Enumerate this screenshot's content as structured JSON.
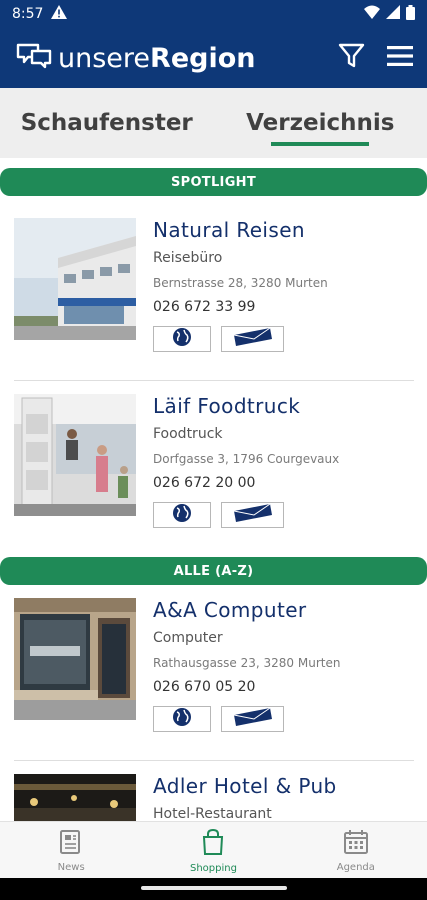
{
  "status_bar": {
    "time": "8:57"
  },
  "app_bar": {
    "brand_light": "unsere",
    "brand_bold": "Region"
  },
  "tabs": [
    {
      "label": "Schaufenster",
      "active": false
    },
    {
      "label": "Verzeichnis",
      "active": true
    }
  ],
  "sections": {
    "spotlight": "SPOTLIGHT",
    "all": "ALLE (A-Z)"
  },
  "listings": [
    {
      "name": "Natural Reisen",
      "category": "Reisebüro",
      "address": "Bernstrasse 28, 3280 Murten",
      "phone": "026 672 33 99"
    },
    {
      "name": "Läif Foodtruck",
      "category": "Foodtruck",
      "address": "Dorfgasse 3, 1796 Courgevaux",
      "phone": "026 672 20 00"
    },
    {
      "name": "A&A Computer",
      "category": "Computer",
      "address": "Rathausgasse 23, 3280 Murten",
      "phone": "026 670 05 20"
    },
    {
      "name": "Adler Hotel & Pub",
      "category": "Hotel-Restaurant"
    }
  ],
  "bottom_nav": [
    {
      "label": "News",
      "icon": "newspaper-icon",
      "active": false
    },
    {
      "label": "Shopping",
      "icon": "shopping-bag-icon",
      "active": true
    },
    {
      "label": "Agenda",
      "icon": "calendar-icon",
      "active": false
    }
  ],
  "colors": {
    "primary": "#0e3878",
    "accent": "#1f8a57",
    "tab_bg": "#eeeeee",
    "title_text": "#14306b"
  }
}
